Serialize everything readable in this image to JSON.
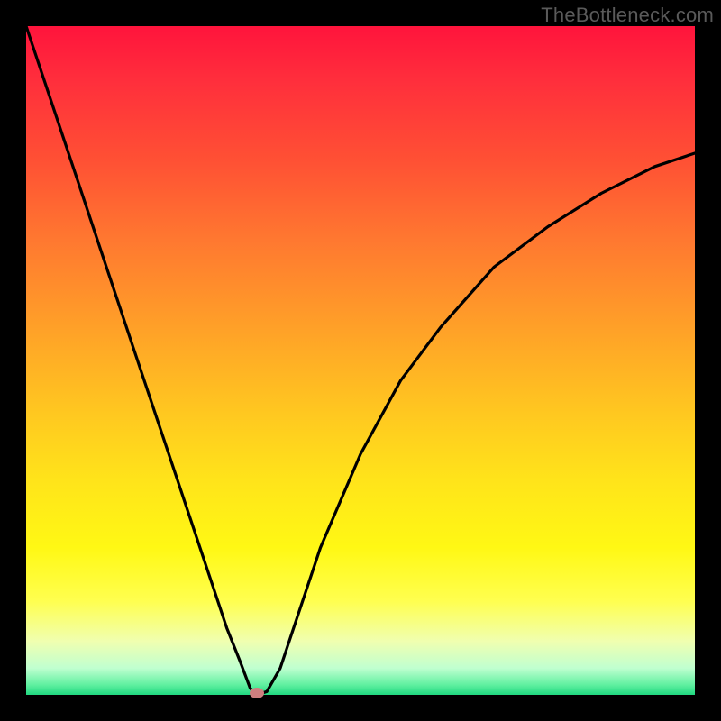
{
  "watermark": "TheBottleneck.com",
  "chart_data": {
    "type": "line",
    "title": "",
    "xlabel": "",
    "ylabel": "",
    "xlim": [
      0,
      1
    ],
    "ylim": [
      0,
      1
    ],
    "series": [
      {
        "name": "bottleneck-curve",
        "x": [
          0.0,
          0.04,
          0.08,
          0.12,
          0.16,
          0.2,
          0.24,
          0.28,
          0.3,
          0.32,
          0.335,
          0.345,
          0.36,
          0.38,
          0.4,
          0.44,
          0.5,
          0.56,
          0.62,
          0.7,
          0.78,
          0.86,
          0.94,
          1.0
        ],
        "y": [
          1.0,
          0.88,
          0.76,
          0.64,
          0.52,
          0.4,
          0.28,
          0.16,
          0.1,
          0.05,
          0.01,
          0.0,
          0.005,
          0.04,
          0.1,
          0.22,
          0.36,
          0.47,
          0.55,
          0.64,
          0.7,
          0.75,
          0.79,
          0.81
        ]
      }
    ],
    "marker": {
      "x": 0.345,
      "y": 0.0
    },
    "gradient_note": "vertical red→yellow→green heatmap background"
  }
}
